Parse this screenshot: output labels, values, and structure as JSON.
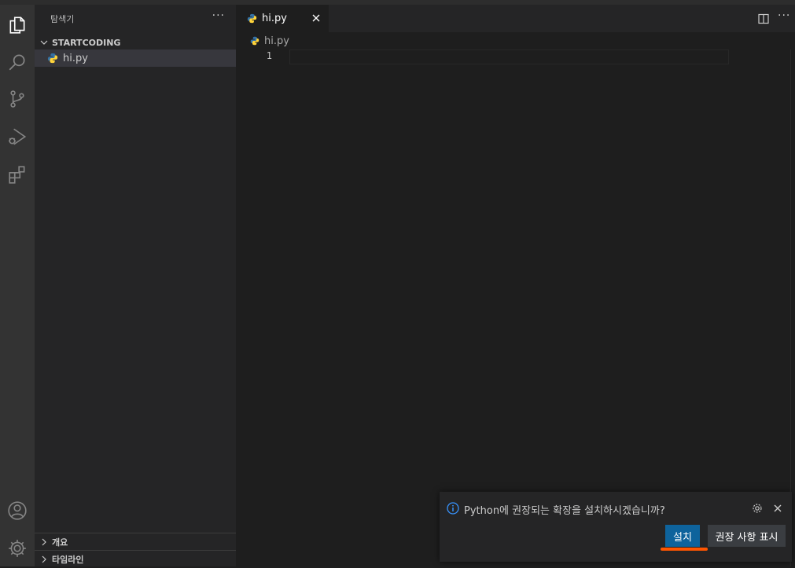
{
  "sidebar": {
    "title": "탐색기",
    "more": "···",
    "folder": "STARTCODING",
    "files": [
      {
        "name": "hi.py",
        "icon": "python-icon"
      }
    ],
    "sections": [
      {
        "label": "개요"
      },
      {
        "label": "타임라인"
      }
    ]
  },
  "editor": {
    "tab": {
      "label": "hi.py"
    },
    "breadcrumb": "hi.py",
    "line_number": "1",
    "more": "···"
  },
  "notification": {
    "message": "Python에 권장되는 확장을 설치하시겠습니까?",
    "install_label": "설치",
    "show_recommendations_label": "권장 사항 표시"
  },
  "colors": {
    "accent": "#0e639c",
    "highlight": "#ff5500",
    "python_blue": "#3572a5",
    "python_yellow": "#ffd43b"
  },
  "activity_icons": [
    "explorer-icon",
    "search-icon",
    "source-control-icon",
    "run-debug-icon",
    "extensions-icon",
    "account-icon",
    "manage-gear-icon"
  ]
}
